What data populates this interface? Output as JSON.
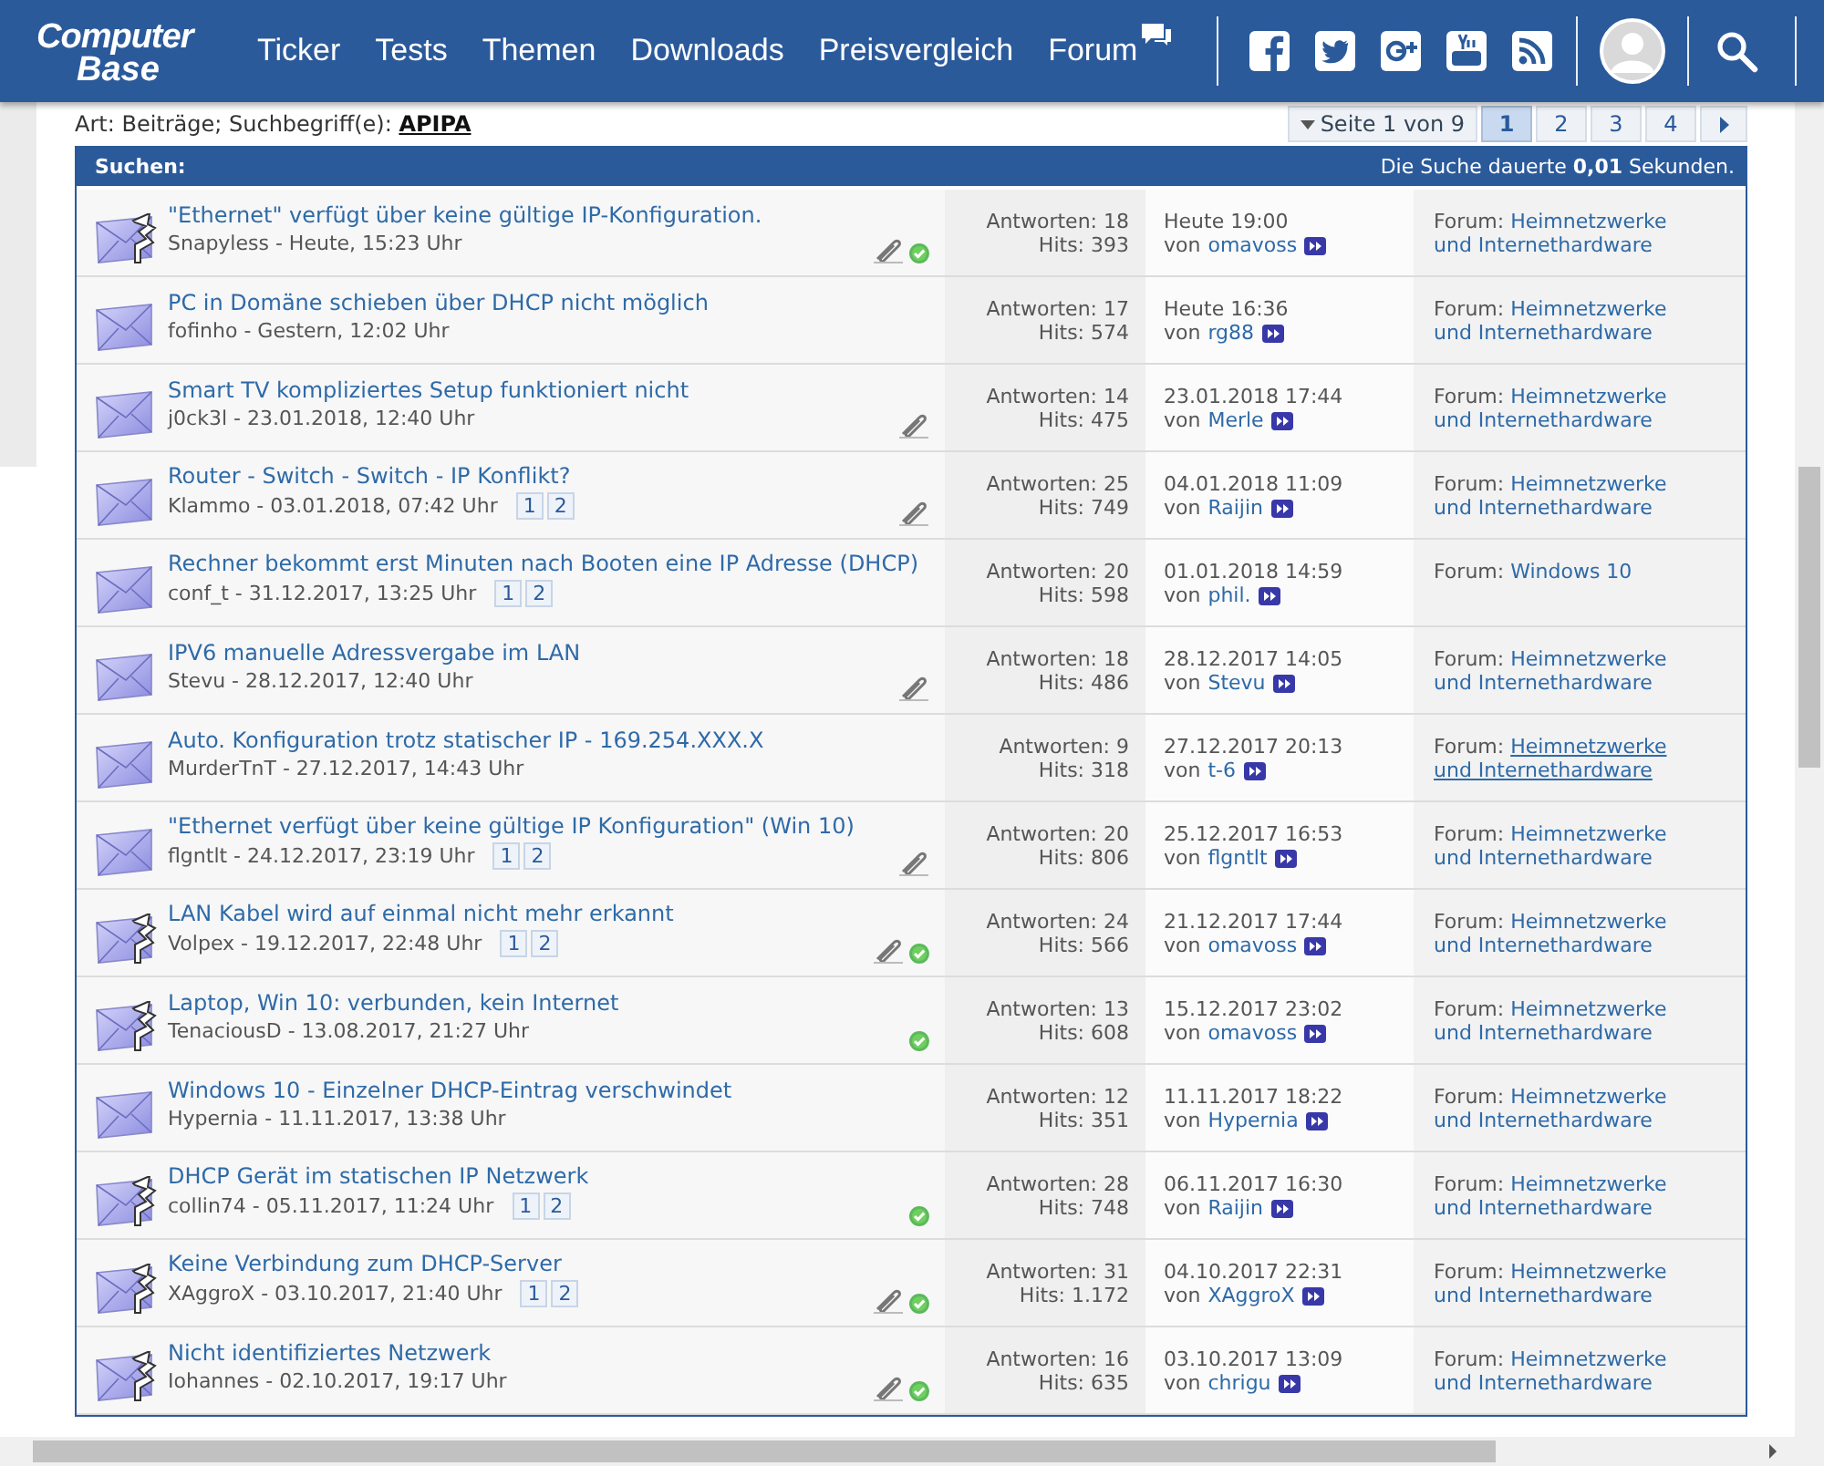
{
  "header": {
    "logo": [
      "Computer",
      "Base"
    ],
    "nav": [
      {
        "label": "Ticker",
        "chat_icon": false
      },
      {
        "label": "Tests",
        "chat_icon": false
      },
      {
        "label": "Themen",
        "chat_icon": false
      },
      {
        "label": "Downloads",
        "chat_icon": false
      },
      {
        "label": "Preisvergleich",
        "chat_icon": false
      },
      {
        "label": "Forum",
        "chat_icon": true
      }
    ],
    "social": [
      {
        "kind": "facebook"
      },
      {
        "kind": "twitter"
      },
      {
        "kind": "googleplus"
      },
      {
        "kind": "youtube"
      },
      {
        "kind": "rss"
      }
    ]
  },
  "search": {
    "prefix": "Art: Beiträge; Suchbegriff(e):",
    "term": "APIPA"
  },
  "pagination": {
    "label": "Seite 1 von 9",
    "pages": [
      {
        "label": "1",
        "selected": true
      },
      {
        "label": "2",
        "selected": false
      },
      {
        "label": "3",
        "selected": false
      },
      {
        "label": "4",
        "selected": false
      }
    ]
  },
  "results": {
    "title": "Suchen:",
    "timing": "Die Suche dauerte **0,01** Sekunden."
  },
  "rows": [
    {
      "kind": "arrow",
      "title": "\"Ethernet\" verfügt über keine gültige IP-Konfiguration.",
      "meta": "Snapyless - Heute, 15:23 Uhr",
      "pages": [],
      "attachment": true,
      "solved": true,
      "replies": "Antworten: 18",
      "hits": "Hits: 393",
      "last_date": "Heute 19:00",
      "by": "von",
      "last_by": "omavoss",
      "forum_prefix": "Forum:",
      "forum": "Heimnetzwerke und Internethardware",
      "hovered": false
    },
    {
      "kind": "plain",
      "title": "PC in Domäne schieben über DHCP nicht möglich",
      "meta": "fofinho - Gestern, 12:02 Uhr",
      "pages": [],
      "attachment": false,
      "solved": false,
      "replies": "Antworten: 17",
      "hits": "Hits: 574",
      "last_date": "Heute 16:36",
      "by": "von",
      "last_by": "rg88",
      "forum_prefix": "Forum:",
      "forum": "Heimnetzwerke und Internethardware",
      "hovered": false
    },
    {
      "kind": "plain",
      "title": "Smart TV kompliziertes Setup funktioniert nicht",
      "meta": "j0ck3l - 23.01.2018, 12:40 Uhr",
      "pages": [],
      "attachment": true,
      "solved": false,
      "replies": "Antworten: 14",
      "hits": "Hits: 475",
      "last_date": "23.01.2018 17:44",
      "by": "von",
      "last_by": "Merle",
      "forum_prefix": "Forum:",
      "forum": "Heimnetzwerke und Internethardware",
      "hovered": false
    },
    {
      "kind": "plain",
      "title": "Router - Switch - Switch - IP Konflikt?",
      "meta": "Klammo - 03.01.2018, 07:42 Uhr",
      "pages": [
        "1",
        "2"
      ],
      "attachment": true,
      "solved": false,
      "replies": "Antworten: 25",
      "hits": "Hits: 749",
      "last_date": "04.01.2018 11:09",
      "by": "von",
      "last_by": "Raijin",
      "forum_prefix": "Forum:",
      "forum": "Heimnetzwerke und Internethardware",
      "hovered": false
    },
    {
      "kind": "plain",
      "title": "Rechner bekommt erst Minuten nach Booten eine IP Adresse (DHCP)",
      "meta": "conf_t - 31.12.2017, 13:25 Uhr",
      "pages": [
        "1",
        "2"
      ],
      "attachment": false,
      "solved": false,
      "replies": "Antworten: 20",
      "hits": "Hits: 598",
      "last_date": "01.01.2018 14:59",
      "by": "von",
      "last_by": "phil.",
      "forum_prefix": "Forum:",
      "forum": "Windows 10",
      "hovered": false
    },
    {
      "kind": "plain",
      "title": "IPV6 manuelle Adressvergabe im LAN",
      "meta": "Stevu - 28.12.2017, 12:40 Uhr",
      "pages": [],
      "attachment": true,
      "solved": false,
      "replies": "Antworten: 18",
      "hits": "Hits: 486",
      "last_date": "28.12.2017 14:05",
      "by": "von",
      "last_by": "Stevu",
      "forum_prefix": "Forum:",
      "forum": "Heimnetzwerke und Internethardware",
      "hovered": false
    },
    {
      "kind": "plain",
      "title": "Auto. Konfiguration trotz statischer IP - 169.254.XXX.X",
      "meta": "MurderTnT - 27.12.2017, 14:43 Uhr",
      "pages": [],
      "attachment": false,
      "solved": false,
      "replies": "Antworten: 9",
      "hits": "Hits: 318",
      "last_date": "27.12.2017 20:13",
      "by": "von",
      "last_by": "t-6",
      "forum_prefix": "Forum:",
      "forum": "Heimnetzwerke und Internethardware",
      "hovered": true
    },
    {
      "kind": "plain",
      "title": "\"Ethernet verfügt über keine gültige IP Konfiguration\" (Win 10)",
      "meta": "flgntlt - 24.12.2017, 23:19 Uhr",
      "pages": [
        "1",
        "2"
      ],
      "attachment": true,
      "solved": false,
      "replies": "Antworten: 20",
      "hits": "Hits: 806",
      "last_date": "25.12.2017 16:53",
      "by": "von",
      "last_by": "flgntlt",
      "forum_prefix": "Forum:",
      "forum": "Heimnetzwerke und Internethardware",
      "hovered": false
    },
    {
      "kind": "arrow",
      "title": "LAN Kabel wird auf einmal nicht mehr erkannt",
      "meta": "Volpex - 19.12.2017, 22:48 Uhr",
      "pages": [
        "1",
        "2"
      ],
      "attachment": true,
      "solved": true,
      "replies": "Antworten: 24",
      "hits": "Hits: 566",
      "last_date": "21.12.2017 17:44",
      "by": "von",
      "last_by": "omavoss",
      "forum_prefix": "Forum:",
      "forum": "Heimnetzwerke und Internethardware",
      "hovered": false
    },
    {
      "kind": "arrow",
      "title": "Laptop, Win 10: verbunden, kein Internet",
      "meta": "TenaciousD - 13.08.2017, 21:27 Uhr",
      "pages": [],
      "attachment": false,
      "solved": true,
      "replies": "Antworten: 13",
      "hits": "Hits: 608",
      "last_date": "15.12.2017 23:02",
      "by": "von",
      "last_by": "omavoss",
      "forum_prefix": "Forum:",
      "forum": "Heimnetzwerke und Internethardware",
      "hovered": false
    },
    {
      "kind": "plain",
      "title": "Windows 10 - Einzelner DHCP-Eintrag verschwindet",
      "meta": "Hypernia - 11.11.2017, 13:38 Uhr",
      "pages": [],
      "attachment": false,
      "solved": false,
      "replies": "Antworten: 12",
      "hits": "Hits: 351",
      "last_date": "11.11.2017 18:22",
      "by": "von",
      "last_by": "Hypernia",
      "forum_prefix": "Forum:",
      "forum": "Heimnetzwerke und Internethardware",
      "hovered": false
    },
    {
      "kind": "arrow",
      "title": "DHCP Gerät im statischen IP Netzwerk",
      "meta": "collin74 - 05.11.2017, 11:24 Uhr",
      "pages": [
        "1",
        "2"
      ],
      "attachment": false,
      "solved": true,
      "replies": "Antworten: 28",
      "hits": "Hits: 748",
      "last_date": "06.11.2017 16:30",
      "by": "von",
      "last_by": "Raijin",
      "forum_prefix": "Forum:",
      "forum": "Heimnetzwerke und Internethardware",
      "hovered": false
    },
    {
      "kind": "arrow",
      "title": "Keine Verbindung zum DHCP-Server",
      "meta": "XAggroX - 03.10.2017, 21:40 Uhr",
      "pages": [
        "1",
        "2"
      ],
      "attachment": true,
      "solved": true,
      "replies": "Antworten: 31",
      "hits": "Hits: 1.172",
      "last_date": "04.10.2017 22:31",
      "by": "von",
      "last_by": "XAggroX",
      "forum_prefix": "Forum:",
      "forum": "Heimnetzwerke und Internethardware",
      "hovered": false
    },
    {
      "kind": "arrow",
      "title": "Nicht identifiziertes Netzwerk",
      "meta": "Iohannes - 02.10.2017, 19:17 Uhr",
      "pages": [],
      "attachment": true,
      "solved": true,
      "replies": "Antworten: 16",
      "hits": "Hits: 635",
      "last_date": "03.10.2017 13:09",
      "by": "von",
      "last_by": "chrigu",
      "forum_prefix": "Forum:",
      "forum": "Heimnetzwerke und Internethardware",
      "hovered": false
    }
  ]
}
